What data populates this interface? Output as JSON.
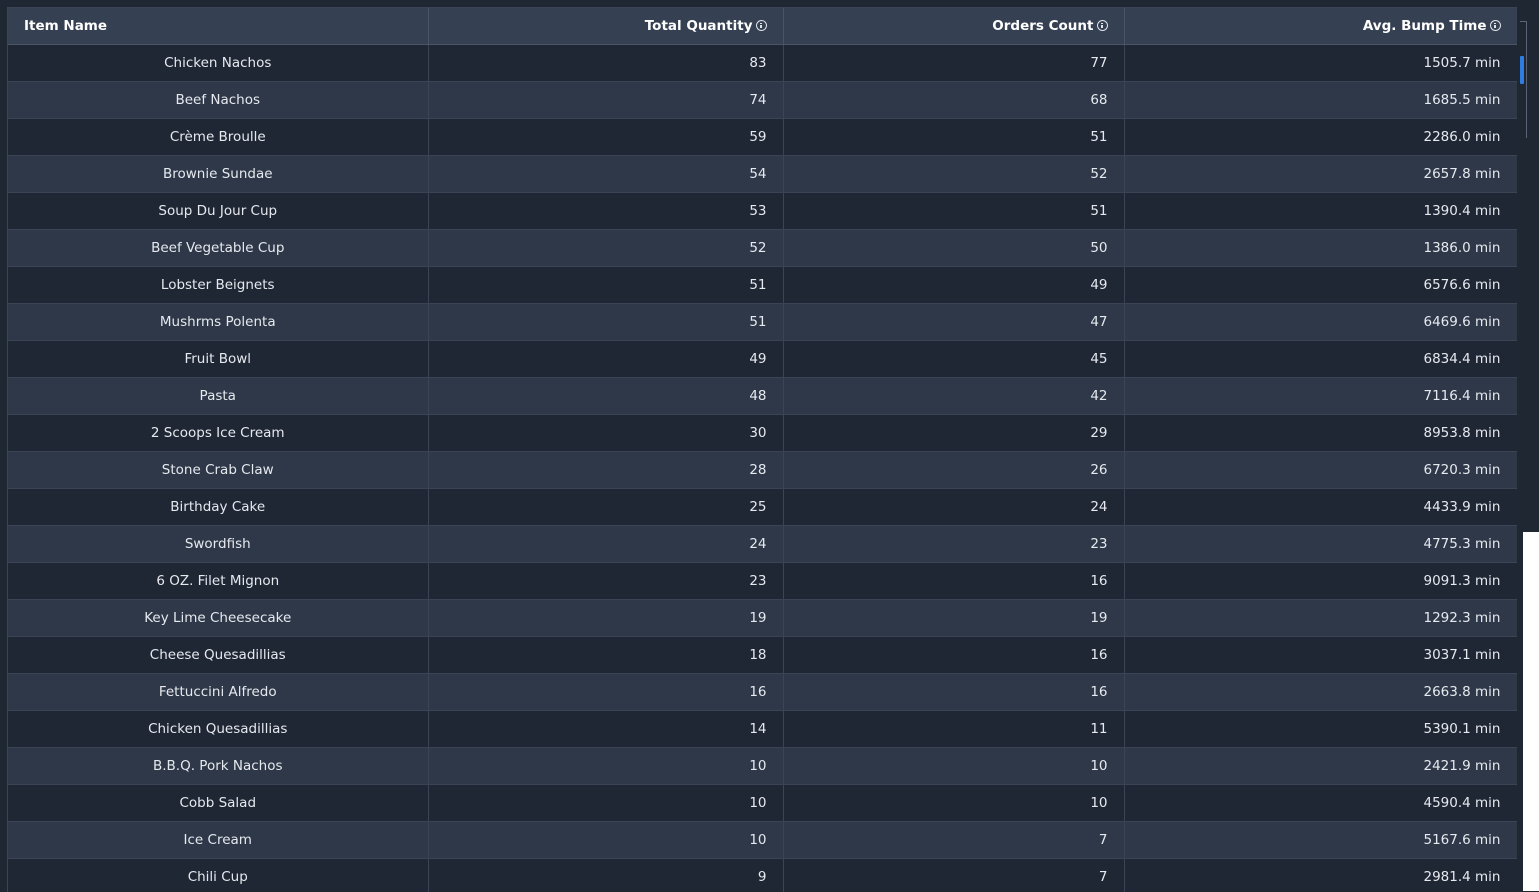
{
  "table": {
    "columns": [
      {
        "label": "Item Name",
        "has_info_icon": false
      },
      {
        "label": "Total Quantity",
        "has_info_icon": true
      },
      {
        "label": "Orders Count",
        "has_info_icon": true
      },
      {
        "label": "Avg. Bump Time",
        "has_info_icon": true
      }
    ],
    "rows": [
      {
        "name": "Chicken Nachos",
        "total_quantity": "83",
        "orders_count": "77",
        "avg_bump_time": "1505.7 min"
      },
      {
        "name": "Beef Nachos",
        "total_quantity": "74",
        "orders_count": "68",
        "avg_bump_time": "1685.5 min"
      },
      {
        "name": "Crème Broulle",
        "total_quantity": "59",
        "orders_count": "51",
        "avg_bump_time": "2286.0 min"
      },
      {
        "name": "Brownie Sundae",
        "total_quantity": "54",
        "orders_count": "52",
        "avg_bump_time": "2657.8 min"
      },
      {
        "name": "Soup Du Jour Cup",
        "total_quantity": "53",
        "orders_count": "51",
        "avg_bump_time": "1390.4 min"
      },
      {
        "name": "Beef Vegetable Cup",
        "total_quantity": "52",
        "orders_count": "50",
        "avg_bump_time": "1386.0 min"
      },
      {
        "name": "Lobster Beignets",
        "total_quantity": "51",
        "orders_count": "49",
        "avg_bump_time": "6576.6 min"
      },
      {
        "name": "Mushrms Polenta",
        "total_quantity": "51",
        "orders_count": "47",
        "avg_bump_time": "6469.6 min"
      },
      {
        "name": "Fruit Bowl",
        "total_quantity": "49",
        "orders_count": "45",
        "avg_bump_time": "6834.4 min"
      },
      {
        "name": "Pasta",
        "total_quantity": "48",
        "orders_count": "42",
        "avg_bump_time": "7116.4 min"
      },
      {
        "name": "2 Scoops Ice Cream",
        "total_quantity": "30",
        "orders_count": "29",
        "avg_bump_time": "8953.8 min"
      },
      {
        "name": "Stone Crab Claw",
        "total_quantity": "28",
        "orders_count": "26",
        "avg_bump_time": "6720.3 min"
      },
      {
        "name": "Birthday Cake",
        "total_quantity": "25",
        "orders_count": "24",
        "avg_bump_time": "4433.9 min"
      },
      {
        "name": "Swordfish",
        "total_quantity": "24",
        "orders_count": "23",
        "avg_bump_time": "4775.3 min"
      },
      {
        "name": "6 OZ. Filet Mignon",
        "total_quantity": "23",
        "orders_count": "16",
        "avg_bump_time": "9091.3 min"
      },
      {
        "name": "Key Lime Cheesecake",
        "total_quantity": "19",
        "orders_count": "19",
        "avg_bump_time": "1292.3 min"
      },
      {
        "name": "Cheese Quesadillias",
        "total_quantity": "18",
        "orders_count": "16",
        "avg_bump_time": "3037.1 min"
      },
      {
        "name": "Fettuccini Alfredo",
        "total_quantity": "16",
        "orders_count": "16",
        "avg_bump_time": "2663.8 min"
      },
      {
        "name": "Chicken Quesadillias",
        "total_quantity": "14",
        "orders_count": "11",
        "avg_bump_time": "5390.1 min"
      },
      {
        "name": "B.B.Q. Pork Nachos",
        "total_quantity": "10",
        "orders_count": "10",
        "avg_bump_time": "2421.9 min"
      },
      {
        "name": "Cobb Salad",
        "total_quantity": "10",
        "orders_count": "10",
        "avg_bump_time": "4590.4 min"
      },
      {
        "name": "Ice Cream",
        "total_quantity": "10",
        "orders_count": "7",
        "avg_bump_time": "5167.6 min"
      },
      {
        "name": "Chili Cup",
        "total_quantity": "9",
        "orders_count": "7",
        "avg_bump_time": "2981.4 min"
      }
    ]
  },
  "colors": {
    "background": "#1f2733",
    "header": "#354052",
    "row_odd": "#1f2735",
    "row_even": "#2e3849",
    "scroll_thumb": "#2f7de1"
  },
  "icons": {
    "column_info": "info-icon"
  }
}
